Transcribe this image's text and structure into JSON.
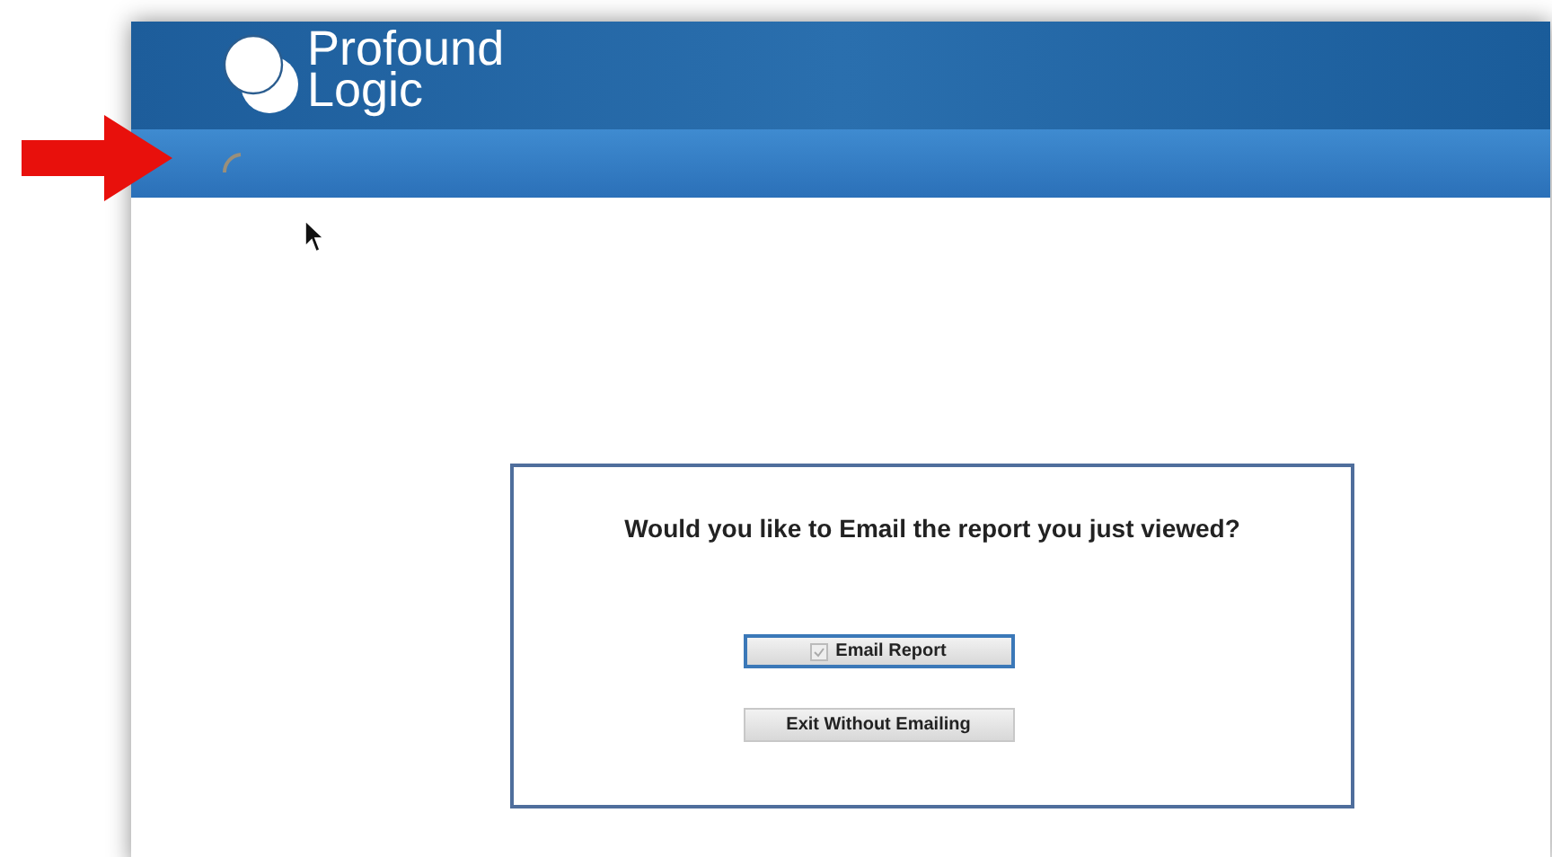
{
  "header": {
    "logo_lines": [
      "Profound",
      "Logic"
    ]
  },
  "dialog": {
    "question": "Would you like to Email the report you just viewed?",
    "buttons": [
      {
        "label": "Email Report",
        "focused": true,
        "kind": "icon"
      },
      {
        "label": "Exit Without Emailing",
        "focused": false,
        "kind": "plain"
      }
    ]
  }
}
